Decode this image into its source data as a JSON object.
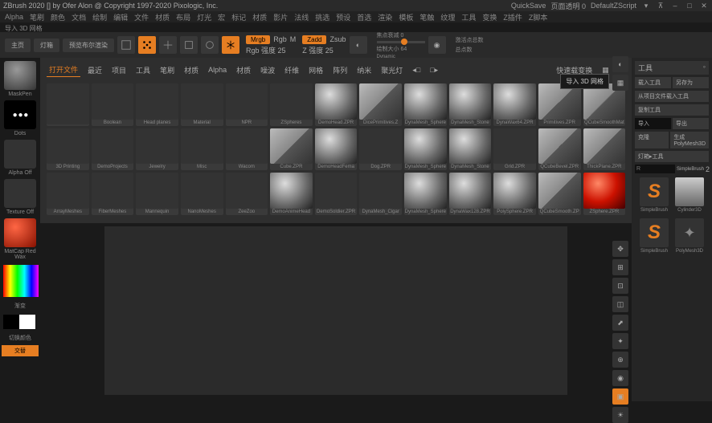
{
  "titlebar": {
    "title": "ZBrush 2020 [] by Ofer Alon @ Copyright 1997-2020 Pixologic, Inc.",
    "quicksave": "QuickSave",
    "transparency": "页面透明 0",
    "script": "DefaultZScript",
    "menu_icon": "▾"
  },
  "topmenu": [
    "Alpha",
    "笔刷",
    "颜色",
    "文档",
    "绘制",
    "编辑",
    "文件",
    "材质",
    "布局",
    "灯光",
    "宏",
    "标记",
    "材质",
    "影片",
    "法线",
    "挑选",
    "预设",
    "首选",
    "渲染",
    "模板",
    "笔触",
    "纹理",
    "工具",
    "变换",
    "Z插件",
    "Z脚本"
  ],
  "subtitle": "导入 3D 网格",
  "toolbar": {
    "home": "主页",
    "lightbox": "灯箱",
    "bpr": "预览布尔渲染",
    "mrgb": "Mrgb",
    "rgb": "Rgb",
    "m": "M",
    "rgb_intensity": "Rgb 强度 25",
    "zadd": "Zadd",
    "zsub": "Zsub",
    "z_intensity": "Z 强度 25",
    "focal_shift": "焦点衰减 0",
    "draw_size": "绘制大小 64",
    "dynamic": "Dynamic",
    "active_points": "激活点总数",
    "total_points": "总点数"
  },
  "left": {
    "brush": "MaskPen",
    "dots": "Dots",
    "alpha": "Alpha Off",
    "texture": "Texture Off",
    "matcap": "MatCap Red Wax",
    "gradient": "渐变",
    "switch_color": "切换颜色",
    "alt": "交替"
  },
  "browser": {
    "tabs": [
      "打开文件",
      "最近",
      "项目",
      "工具",
      "笔刷",
      "材质",
      "Alpha",
      "材质",
      "噪波",
      "纤维",
      "网格",
      "阵列",
      "纳米",
      "聚光灯"
    ],
    "quickload": "快速载变换",
    "r1": [
      {
        "label": "",
        "type": "folder"
      },
      {
        "label": "Boolean",
        "type": "folder"
      },
      {
        "label": "Head planes",
        "type": "folder"
      },
      {
        "label": "Material",
        "type": "folder"
      },
      {
        "label": "NPR",
        "type": "folder"
      },
      {
        "label": "ZSpheres",
        "type": "folder"
      },
      {
        "label": "DemoHead.ZPR",
        "type": "head"
      },
      {
        "label": "DicePrimitives.Z",
        "type": "cube"
      },
      {
        "label": "DynaMesh_Sphere",
        "type": "sphere"
      },
      {
        "label": "DynaMesh_Stone",
        "type": "sphere"
      },
      {
        "label": "DynaWax64.ZPR",
        "type": "sphere"
      },
      {
        "label": "Primitives.ZPR",
        "type": "cube"
      },
      {
        "label": "QCubeSmoothMat",
        "type": "cube"
      }
    ],
    "r2": [
      {
        "label": "3D Printing",
        "type": "folder"
      },
      {
        "label": "DemoProjects",
        "type": "folder"
      },
      {
        "label": "Jewelry",
        "type": "folder"
      },
      {
        "label": "Misc",
        "type": "folder"
      },
      {
        "label": "Wacom",
        "type": "folder"
      },
      {
        "label": "Cube.ZPR",
        "type": "cube"
      },
      {
        "label": "DemoHeadFema",
        "type": "head"
      },
      {
        "label": "Dog.ZPR",
        "type": "misc"
      },
      {
        "label": "DynaMesh_Sphere",
        "type": "sphere"
      },
      {
        "label": "DynaMesh_Stone",
        "type": "sphere"
      },
      {
        "label": "Grid.ZPR",
        "type": "misc"
      },
      {
        "label": "QCubeBevel.ZPR",
        "type": "cube"
      },
      {
        "label": "ThickPlane.ZPR",
        "type": "cube"
      }
    ],
    "r3": [
      {
        "label": "ArrayMeshes",
        "type": "folder"
      },
      {
        "label": "FiberMeshes",
        "type": "folder"
      },
      {
        "label": "Mannequin",
        "type": "folder"
      },
      {
        "label": "NanoMeshes",
        "type": "folder"
      },
      {
        "label": "ZeeZoo",
        "type": "folder"
      },
      {
        "label": "DemoAnimeHead",
        "type": "head"
      },
      {
        "label": "DemoSoldier.ZPR",
        "type": "misc"
      },
      {
        "label": "DynaMesh_Cigar",
        "type": "misc"
      },
      {
        "label": "DynaMesh_Sphere",
        "type": "sphere"
      },
      {
        "label": "DynaWax128.ZPR",
        "type": "sphere"
      },
      {
        "label": "PolySphere.ZPR",
        "type": "sphere"
      },
      {
        "label": "QCubeSmooth.ZP",
        "type": "cube"
      },
      {
        "label": "ZSphere.ZPR",
        "type": "sphere-red"
      }
    ]
  },
  "right": {
    "title": "工具",
    "load": "载入工具",
    "save": "另存为",
    "import_file": "从项目文件载入工具",
    "copy": "复制工具",
    "import": "导入",
    "export": "导出",
    "clone": "克隆",
    "make_polymesh": "生成 PolyMesh3D",
    "lightbox_tools": "灯箱▸工具",
    "simplebrush": "SimpleBrush",
    "simplebrush2": "SimpleBrush",
    "cylinder": "Cylinder3D",
    "polymesh": "PolyMesh3D",
    "r_placeholder": "R",
    "count": "2"
  },
  "tooltip": "导入 3D 网格"
}
